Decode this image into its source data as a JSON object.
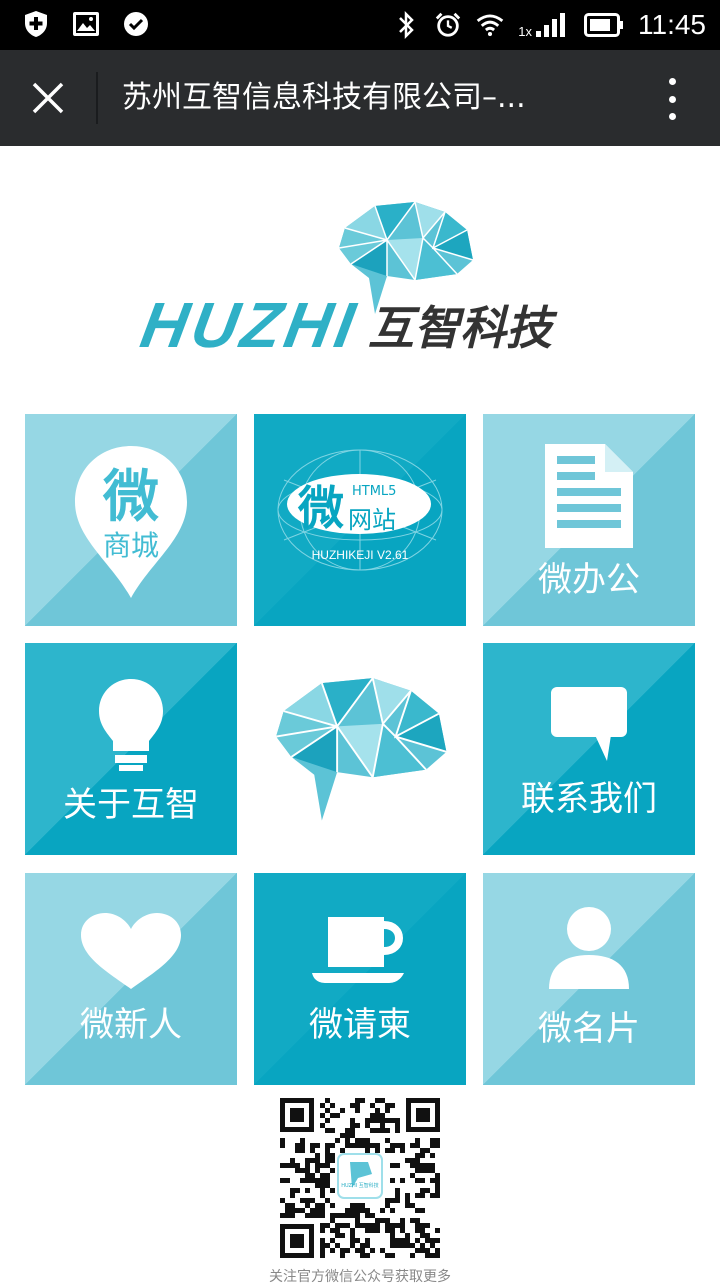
{
  "status_bar": {
    "time": "11:45",
    "signal_label": "1x",
    "icons": [
      "shield-plus-icon",
      "image-icon",
      "check-circle-icon",
      "bluetooth-icon",
      "alarm-icon",
      "wifi-icon",
      "signal-icon",
      "battery-icon"
    ]
  },
  "toolbar": {
    "title": "苏州互智信息科技有限公司–...",
    "close_icon": "close-icon",
    "more_icon": "more-vertical-icon"
  },
  "logo": {
    "text_en": "HUZHI",
    "text_cn": "互智科技"
  },
  "tiles": {
    "mall": {
      "big": "微",
      "small": "商城"
    },
    "website": {
      "big": "微",
      "html5": "HTML5",
      "small": "网站",
      "version": "HUZHIKEJI V2.61"
    },
    "office": {
      "label": "微办公"
    },
    "about": {
      "label": "关于互智"
    },
    "contact": {
      "label": "联系我们"
    },
    "newlywed": {
      "label": "微新人"
    },
    "invite": {
      "label": "微请柬"
    },
    "card": {
      "label": "微名片"
    }
  },
  "qr": {
    "logo_text": "HUZHI 互智科技",
    "caption": "关注官方微信公众号获取更多"
  },
  "colors": {
    "tile_light": "#7dcfdf",
    "tile_mid": "#42bcd3",
    "tile_dark": "#08a5c1",
    "brand": "#2fb0c6",
    "toolbar": "#2a2c2e"
  }
}
